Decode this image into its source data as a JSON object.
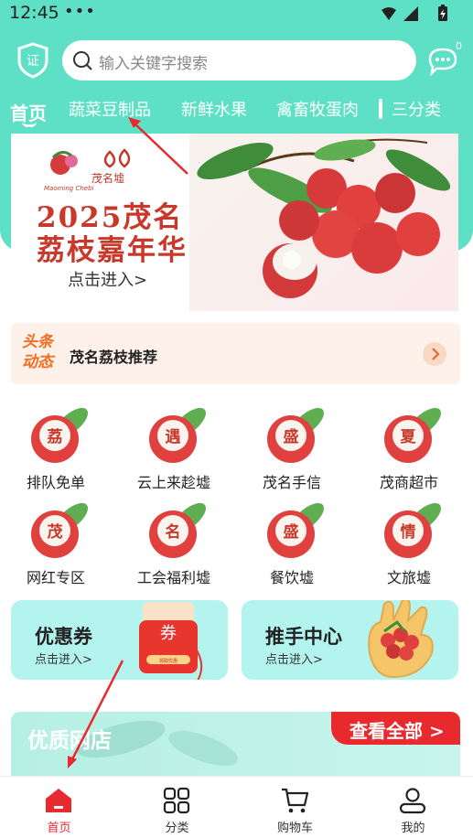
{
  "status_bar": {
    "time": "12:45",
    "dots": "•••"
  },
  "header": {
    "search_placeholder": "输入关键字搜索",
    "shield_glyph": "证",
    "message_badge": "0"
  },
  "tabs": [
    {
      "label": "首页",
      "active": true
    },
    {
      "label": "蔬菜豆制品"
    },
    {
      "label": "新鲜水果"
    },
    {
      "label": "禽畜牧蛋肉"
    }
  ],
  "category_button": {
    "label": "三分类"
  },
  "banner": {
    "logo_text": "茂名墟",
    "logo_caption": "Maoming Chebi",
    "line1": "2025茂名",
    "line2": "荔枝嘉年华",
    "enter": "点击进入>"
  },
  "headline": {
    "tag": "头条动态",
    "text": "茂名荔枝推荐"
  },
  "grid": [
    {
      "char": "荔",
      "label": "排队免单"
    },
    {
      "char": "遇",
      "label": "云上来趁墟"
    },
    {
      "char": "盛",
      "label": "茂名手信"
    },
    {
      "char": "夏",
      "label": "茂商超市"
    },
    {
      "char": "茂",
      "label": "网红专区"
    },
    {
      "char": "名",
      "label": "工会福利墟"
    },
    {
      "char": "盛",
      "label": "餐饮墟"
    },
    {
      "char": "情",
      "label": "文旅墟"
    }
  ],
  "cards": [
    {
      "title": "优惠券",
      "sub": "点击进入>",
      "coupon_char": "券",
      "coupon_btn": "领取优惠"
    },
    {
      "title": "推手中心",
      "sub": "点击进入>"
    }
  ],
  "shops": {
    "title": "优质网店",
    "view_all": "查看全部 >"
  },
  "bottom_nav": [
    {
      "label": "首页",
      "active": true
    },
    {
      "label": "分类"
    },
    {
      "label": "购物车"
    },
    {
      "label": "我的"
    }
  ],
  "colors": {
    "header_bg": "#5ee0c6",
    "accent_red": "#e8292d",
    "banner_red": "#c8392b"
  }
}
